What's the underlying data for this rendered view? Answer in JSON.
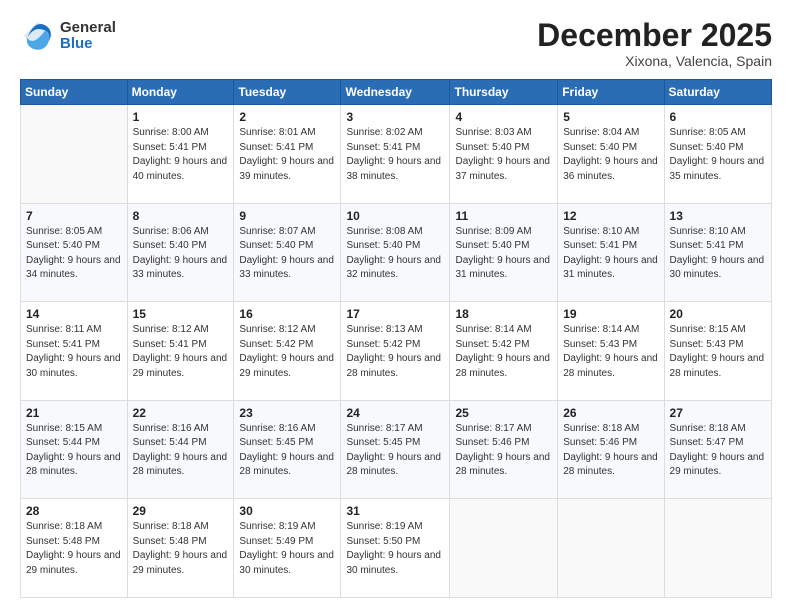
{
  "logo": {
    "general": "General",
    "blue": "Blue"
  },
  "header": {
    "month": "December 2025",
    "location": "Xixona, Valencia, Spain"
  },
  "days_of_week": [
    "Sunday",
    "Monday",
    "Tuesday",
    "Wednesday",
    "Thursday",
    "Friday",
    "Saturday"
  ],
  "weeks": [
    [
      {
        "day": "",
        "sunrise": "",
        "sunset": "",
        "daylight": ""
      },
      {
        "day": "1",
        "sunrise": "Sunrise: 8:00 AM",
        "sunset": "Sunset: 5:41 PM",
        "daylight": "Daylight: 9 hours and 40 minutes."
      },
      {
        "day": "2",
        "sunrise": "Sunrise: 8:01 AM",
        "sunset": "Sunset: 5:41 PM",
        "daylight": "Daylight: 9 hours and 39 minutes."
      },
      {
        "day": "3",
        "sunrise": "Sunrise: 8:02 AM",
        "sunset": "Sunset: 5:41 PM",
        "daylight": "Daylight: 9 hours and 38 minutes."
      },
      {
        "day": "4",
        "sunrise": "Sunrise: 8:03 AM",
        "sunset": "Sunset: 5:40 PM",
        "daylight": "Daylight: 9 hours and 37 minutes."
      },
      {
        "day": "5",
        "sunrise": "Sunrise: 8:04 AM",
        "sunset": "Sunset: 5:40 PM",
        "daylight": "Daylight: 9 hours and 36 minutes."
      },
      {
        "day": "6",
        "sunrise": "Sunrise: 8:05 AM",
        "sunset": "Sunset: 5:40 PM",
        "daylight": "Daylight: 9 hours and 35 minutes."
      }
    ],
    [
      {
        "day": "7",
        "sunrise": "Sunrise: 8:05 AM",
        "sunset": "Sunset: 5:40 PM",
        "daylight": "Daylight: 9 hours and 34 minutes."
      },
      {
        "day": "8",
        "sunrise": "Sunrise: 8:06 AM",
        "sunset": "Sunset: 5:40 PM",
        "daylight": "Daylight: 9 hours and 33 minutes."
      },
      {
        "day": "9",
        "sunrise": "Sunrise: 8:07 AM",
        "sunset": "Sunset: 5:40 PM",
        "daylight": "Daylight: 9 hours and 33 minutes."
      },
      {
        "day": "10",
        "sunrise": "Sunrise: 8:08 AM",
        "sunset": "Sunset: 5:40 PM",
        "daylight": "Daylight: 9 hours and 32 minutes."
      },
      {
        "day": "11",
        "sunrise": "Sunrise: 8:09 AM",
        "sunset": "Sunset: 5:40 PM",
        "daylight": "Daylight: 9 hours and 31 minutes."
      },
      {
        "day": "12",
        "sunrise": "Sunrise: 8:10 AM",
        "sunset": "Sunset: 5:41 PM",
        "daylight": "Daylight: 9 hours and 31 minutes."
      },
      {
        "day": "13",
        "sunrise": "Sunrise: 8:10 AM",
        "sunset": "Sunset: 5:41 PM",
        "daylight": "Daylight: 9 hours and 30 minutes."
      }
    ],
    [
      {
        "day": "14",
        "sunrise": "Sunrise: 8:11 AM",
        "sunset": "Sunset: 5:41 PM",
        "daylight": "Daylight: 9 hours and 30 minutes."
      },
      {
        "day": "15",
        "sunrise": "Sunrise: 8:12 AM",
        "sunset": "Sunset: 5:41 PM",
        "daylight": "Daylight: 9 hours and 29 minutes."
      },
      {
        "day": "16",
        "sunrise": "Sunrise: 8:12 AM",
        "sunset": "Sunset: 5:42 PM",
        "daylight": "Daylight: 9 hours and 29 minutes."
      },
      {
        "day": "17",
        "sunrise": "Sunrise: 8:13 AM",
        "sunset": "Sunset: 5:42 PM",
        "daylight": "Daylight: 9 hours and 28 minutes."
      },
      {
        "day": "18",
        "sunrise": "Sunrise: 8:14 AM",
        "sunset": "Sunset: 5:42 PM",
        "daylight": "Daylight: 9 hours and 28 minutes."
      },
      {
        "day": "19",
        "sunrise": "Sunrise: 8:14 AM",
        "sunset": "Sunset: 5:43 PM",
        "daylight": "Daylight: 9 hours and 28 minutes."
      },
      {
        "day": "20",
        "sunrise": "Sunrise: 8:15 AM",
        "sunset": "Sunset: 5:43 PM",
        "daylight": "Daylight: 9 hours and 28 minutes."
      }
    ],
    [
      {
        "day": "21",
        "sunrise": "Sunrise: 8:15 AM",
        "sunset": "Sunset: 5:44 PM",
        "daylight": "Daylight: 9 hours and 28 minutes."
      },
      {
        "day": "22",
        "sunrise": "Sunrise: 8:16 AM",
        "sunset": "Sunset: 5:44 PM",
        "daylight": "Daylight: 9 hours and 28 minutes."
      },
      {
        "day": "23",
        "sunrise": "Sunrise: 8:16 AM",
        "sunset": "Sunset: 5:45 PM",
        "daylight": "Daylight: 9 hours and 28 minutes."
      },
      {
        "day": "24",
        "sunrise": "Sunrise: 8:17 AM",
        "sunset": "Sunset: 5:45 PM",
        "daylight": "Daylight: 9 hours and 28 minutes."
      },
      {
        "day": "25",
        "sunrise": "Sunrise: 8:17 AM",
        "sunset": "Sunset: 5:46 PM",
        "daylight": "Daylight: 9 hours and 28 minutes."
      },
      {
        "day": "26",
        "sunrise": "Sunrise: 8:18 AM",
        "sunset": "Sunset: 5:46 PM",
        "daylight": "Daylight: 9 hours and 28 minutes."
      },
      {
        "day": "27",
        "sunrise": "Sunrise: 8:18 AM",
        "sunset": "Sunset: 5:47 PM",
        "daylight": "Daylight: 9 hours and 29 minutes."
      }
    ],
    [
      {
        "day": "28",
        "sunrise": "Sunrise: 8:18 AM",
        "sunset": "Sunset: 5:48 PM",
        "daylight": "Daylight: 9 hours and 29 minutes."
      },
      {
        "day": "29",
        "sunrise": "Sunrise: 8:18 AM",
        "sunset": "Sunset: 5:48 PM",
        "daylight": "Daylight: 9 hours and 29 minutes."
      },
      {
        "day": "30",
        "sunrise": "Sunrise: 8:19 AM",
        "sunset": "Sunset: 5:49 PM",
        "daylight": "Daylight: 9 hours and 30 minutes."
      },
      {
        "day": "31",
        "sunrise": "Sunrise: 8:19 AM",
        "sunset": "Sunset: 5:50 PM",
        "daylight": "Daylight: 9 hours and 30 minutes."
      },
      {
        "day": "",
        "sunrise": "",
        "sunset": "",
        "daylight": ""
      },
      {
        "day": "",
        "sunrise": "",
        "sunset": "",
        "daylight": ""
      },
      {
        "day": "",
        "sunrise": "",
        "sunset": "",
        "daylight": ""
      }
    ]
  ]
}
